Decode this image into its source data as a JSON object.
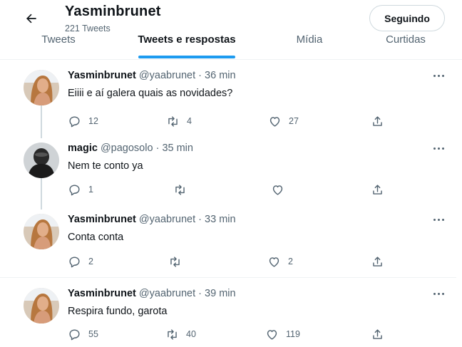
{
  "header": {
    "title": "Yasminbrunet",
    "tweet_count": "221 Tweets",
    "follow_label": "Seguindo"
  },
  "tabs": [
    {
      "label": "Tweets",
      "active": false
    },
    {
      "label": "Tweets e respostas",
      "active": true
    },
    {
      "label": "Mídia",
      "active": false
    },
    {
      "label": "Curtidas",
      "active": false
    }
  ],
  "colors": {
    "accent": "#1d9bf0",
    "text": "#0f1419",
    "muted": "#536471"
  },
  "tweets": [
    {
      "name": "Yasminbrunet",
      "handle": "@yaabrunet",
      "time": "36 min",
      "text": "Eiiii e aí galera quais as novidades?",
      "replies": "12",
      "retweets": "4",
      "likes": "27",
      "avatar": "yasmin-avatar"
    },
    {
      "name": "magic",
      "handle": "@pagosolo",
      "time": "35 min",
      "text": "Nem te conto ya",
      "replies": "1",
      "retweets": "",
      "likes": "",
      "avatar": "magic-avatar"
    },
    {
      "name": "Yasminbrunet",
      "handle": "@yaabrunet",
      "time": "33 min",
      "text": "Conta conta",
      "replies": "2",
      "retweets": "",
      "likes": "2",
      "avatar": "yasmin-avatar"
    },
    {
      "name": "Yasminbrunet",
      "handle": "@yaabrunet",
      "time": "39 min",
      "text": "Respira fundo, garota",
      "replies": "55",
      "retweets": "40",
      "likes": "119",
      "avatar": "yasmin-avatar"
    }
  ]
}
